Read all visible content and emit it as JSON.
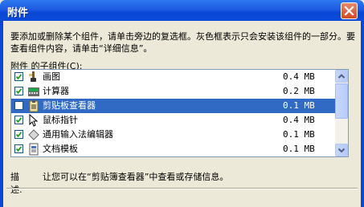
{
  "window": {
    "title": "附件"
  },
  "description": "要添加或删除某个组件，请单击旁边的复选框。灰色框表示只会安装该组件的一部分。要查看组件内容，请单击“详细信息”。",
  "list": {
    "label": "附件 的子组件(C):",
    "items": [
      {
        "name": "画图",
        "size": "0.4 MB",
        "checked": true,
        "icon": "paint-icon"
      },
      {
        "name": "计算器",
        "size": "0.2 MB",
        "checked": true,
        "icon": "calculator-icon"
      },
      {
        "name": "剪贴板查看器",
        "size": "0.1 MB",
        "checked": false,
        "selected": true,
        "icon": "clipboard-viewer-icon"
      },
      {
        "name": "鼠标指针",
        "size": "0.4 MB",
        "checked": true,
        "icon": "mouse-pointer-icon"
      },
      {
        "name": "通用输入法编辑器",
        "size": "0.1 MB",
        "checked": true,
        "icon": "ime-icon"
      },
      {
        "name": "文档模板",
        "size": "0.1 MB",
        "checked": true,
        "icon": "document-template-icon"
      }
    ]
  },
  "footer": {
    "label": "描述:",
    "text": "让您可以在“剪贴簿查看器”中查看或存储信息。"
  },
  "colors": {
    "selection": "#316AC5",
    "titlebar": "#0A46D8",
    "face": "#ECE9D8"
  }
}
